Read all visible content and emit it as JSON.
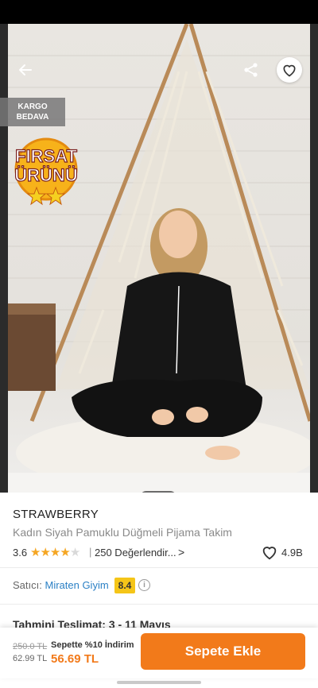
{
  "colors": {
    "accent": "#f27a1a",
    "seller_link": "#2b80c5",
    "score_badge": "#f5c518",
    "star": "#f5a623"
  },
  "hero": {
    "icons": {
      "back": "arrow-left-icon",
      "share": "share-icon",
      "favorite": "heart-icon"
    },
    "badge_line1": "KARGO",
    "badge_line2": "BEDAVA",
    "firsat_line1": "FIRSAT",
    "firsat_line2": "ÜRÜNÜ",
    "carousel": {
      "pages": 2,
      "active": 1
    }
  },
  "product": {
    "brand": "STRAWBERRY",
    "name": "Kadın Siyah Pamuklu Düğmeli Pijama Takim",
    "rating": "3.6",
    "stars_value": 3.6,
    "separator": "|",
    "reviews": "250 Değerlendir...",
    "chevron": ">",
    "likes": "4.9B"
  },
  "seller": {
    "label": "Satıcı:",
    "name": "Miraten Giyim",
    "score": "8.4",
    "info": "i"
  },
  "delivery": {
    "text": "Tahmini Teslimat: 3 - 11 Mayıs"
  },
  "bottom": {
    "old_price": "250.0 TL",
    "mid_price": "62.99 TL",
    "promo": "Sepette %10 İndirim",
    "final_price": "56.69 TL",
    "add_to_cart": "Sepete Ekle"
  }
}
